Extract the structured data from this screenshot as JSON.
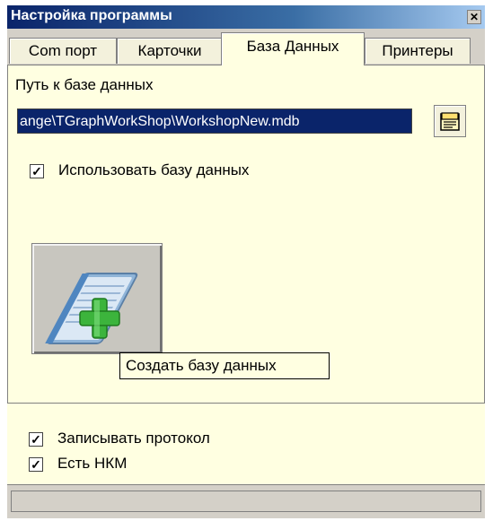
{
  "window": {
    "title": "Настройка программы",
    "close_glyph": "✕"
  },
  "tabs": [
    {
      "label": "Com порт"
    },
    {
      "label": "Карточки"
    },
    {
      "label": "База Данных",
      "active": true
    },
    {
      "label": "Принтеры"
    }
  ],
  "db_panel": {
    "path_label": "Путь к базе данных",
    "path_value": "ange\\TGraphWorkShop\\WorkshopNew.mdb",
    "browse_icon": "document-icon",
    "use_db_label": "Использовать базу данных",
    "use_db_checked": true,
    "create_db_icon": "notebook-add-icon",
    "create_db_tooltip": "Создать базу данных"
  },
  "options": {
    "write_log_label": "Записывать протокол",
    "write_log_checked": true,
    "nkm_label": "Есть НКМ",
    "nkm_checked": true
  },
  "colors": {
    "panel_bg": "#ffffe1",
    "title_gradient_start": "#0a246a",
    "selection_bg": "#0a246a",
    "add_green": "#3cb43c"
  }
}
